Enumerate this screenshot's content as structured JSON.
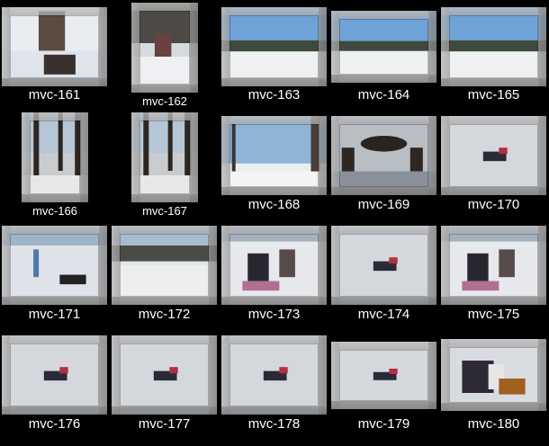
{
  "thumbnails": [
    {
      "label": "mvc-161",
      "scene": "sled-pull"
    },
    {
      "label": "mvc-162",
      "scene": "walk-woods"
    },
    {
      "label": "mvc-163",
      "scene": "field-sky"
    },
    {
      "label": "mvc-164",
      "scene": "field-sky"
    },
    {
      "label": "mvc-165",
      "scene": "field-sky"
    },
    {
      "label": "mvc-166",
      "scene": "woods"
    },
    {
      "label": "mvc-167",
      "scene": "woods"
    },
    {
      "label": "mvc-168",
      "scene": "trees-sky"
    },
    {
      "label": "mvc-169",
      "scene": "picnic-table"
    },
    {
      "label": "mvc-170",
      "scene": "sledder"
    },
    {
      "label": "mvc-171",
      "scene": "hill-people"
    },
    {
      "label": "mvc-172",
      "scene": "hill-valley"
    },
    {
      "label": "mvc-173",
      "scene": "group-snow"
    },
    {
      "label": "mvc-174",
      "scene": "sledder"
    },
    {
      "label": "mvc-175",
      "scene": "group-snow"
    },
    {
      "label": "mvc-176",
      "scene": "sledder"
    },
    {
      "label": "mvc-177",
      "scene": "sledder"
    },
    {
      "label": "mvc-178",
      "scene": "sledder"
    },
    {
      "label": "mvc-179",
      "scene": "sledder"
    },
    {
      "label": "mvc-180",
      "scene": "kids-sled"
    }
  ]
}
